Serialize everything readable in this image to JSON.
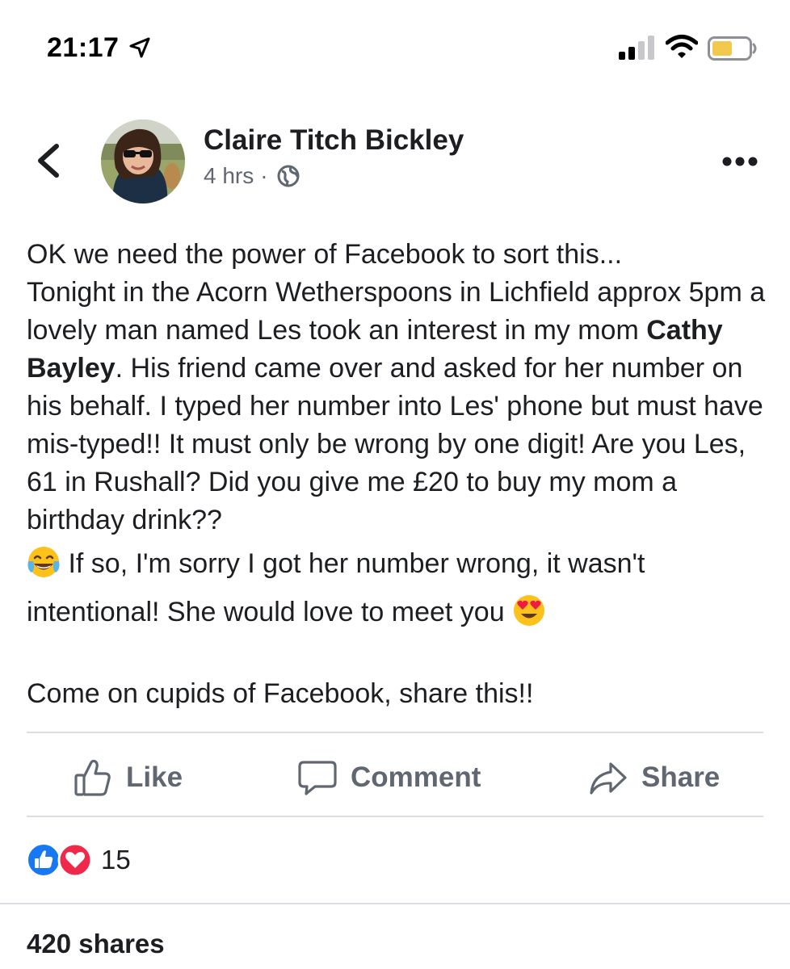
{
  "status_bar": {
    "time": "21:17",
    "icons": [
      "location-arrow-icon",
      "cellular-signal-icon",
      "wifi-icon",
      "battery-icon"
    ],
    "battery_color": "#f2c94c"
  },
  "post": {
    "author": "Claire Titch Bickley",
    "time_ago": "4 hrs",
    "separator": "·",
    "privacy_icon": "globe-icon",
    "body": {
      "line1": "OK we need the power of Facebook to sort this...",
      "line2_before": "Tonight in the Acorn Wetherspoons in Lichfield approx 5pm a lovely man named Les took an interest in my mom ",
      "tagged_person": "Cathy Bayley",
      "line2_after": ". His friend came over and asked for her number on his behalf. I typed her number into Les' phone but must have mis-typed!! It must only be wrong by one digit! Are you Les, 61 in Rushall? Did you give me £20 to buy my mom a birthday drink??",
      "emoji_1": "tears-of-joy-emoji",
      "line3": " If so, I'm sorry I got her number wrong, it wasn't intentional! She would love to meet you ",
      "emoji_2": "heart-eyes-emoji",
      "closing": "Come on cupids of Facebook, share this!!"
    }
  },
  "actions": {
    "like": "Like",
    "comment": "Comment",
    "share": "Share"
  },
  "reactions": {
    "types": [
      "like-reaction-icon",
      "love-reaction-icon"
    ],
    "count": "15",
    "like_color": "#1877f2",
    "love_color": "#f0284a"
  },
  "shares": {
    "label": "420 shares"
  },
  "colors": {
    "text": "#1c1e21",
    "secondary": "#606770",
    "divider": "#dadde1"
  }
}
